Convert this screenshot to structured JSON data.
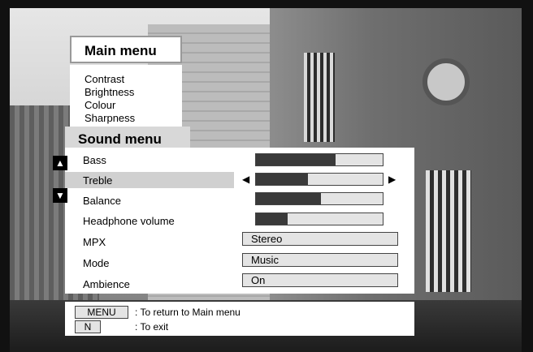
{
  "main_menu": {
    "title": "Main menu",
    "items": [
      "Contrast",
      "Brightness",
      "Colour",
      "Sharpness"
    ]
  },
  "sound_menu": {
    "title": "Sound menu",
    "selected": "Treble",
    "rows": [
      {
        "label": "Bass",
        "type": "slider",
        "level": 0.63
      },
      {
        "label": "Treble",
        "type": "slider",
        "level": 0.41
      },
      {
        "label": "Balance",
        "type": "slider",
        "level": 0.51
      },
      {
        "label": "Headphone volume",
        "type": "slider",
        "level": 0.25
      },
      {
        "label": "MPX",
        "type": "option",
        "value": "Stereo"
      },
      {
        "label": "Mode",
        "type": "option",
        "value": "Music"
      },
      {
        "label": "Ambience",
        "type": "option",
        "value": "On"
      }
    ]
  },
  "help": {
    "menu_key": "MENU",
    "menu_text": ": To return to Main menu",
    "exit_key": "N",
    "exit_text": ": To exit"
  },
  "icons": {
    "scroll_up": "arrow-up-icon",
    "scroll_down": "arrow-down-icon",
    "select_left": "triangle-left-icon",
    "select_right": "triangle-right-icon"
  }
}
